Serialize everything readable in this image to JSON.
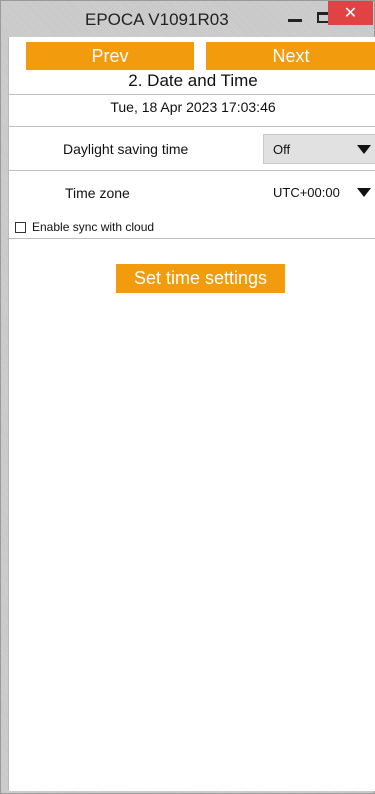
{
  "window": {
    "title": "EPOCA V1091R03",
    "close_glyph": "✕"
  },
  "nav": {
    "prev_label": "Prev",
    "next_label": "Next"
  },
  "page": {
    "title": "2. Date and Time",
    "datetime": "Tue, 18 Apr 2023 17:03:46"
  },
  "settings": {
    "dst_label": "Daylight saving time",
    "dst_value": "Off",
    "tz_label": "Time zone",
    "tz_value": "UTC+00:00",
    "cloud_sync_label": "Enable sync with cloud",
    "cloud_sync_checked": false
  },
  "actions": {
    "set_label": "Set time settings"
  },
  "colors": {
    "accent": "#f29c0d",
    "close": "#e04343"
  }
}
